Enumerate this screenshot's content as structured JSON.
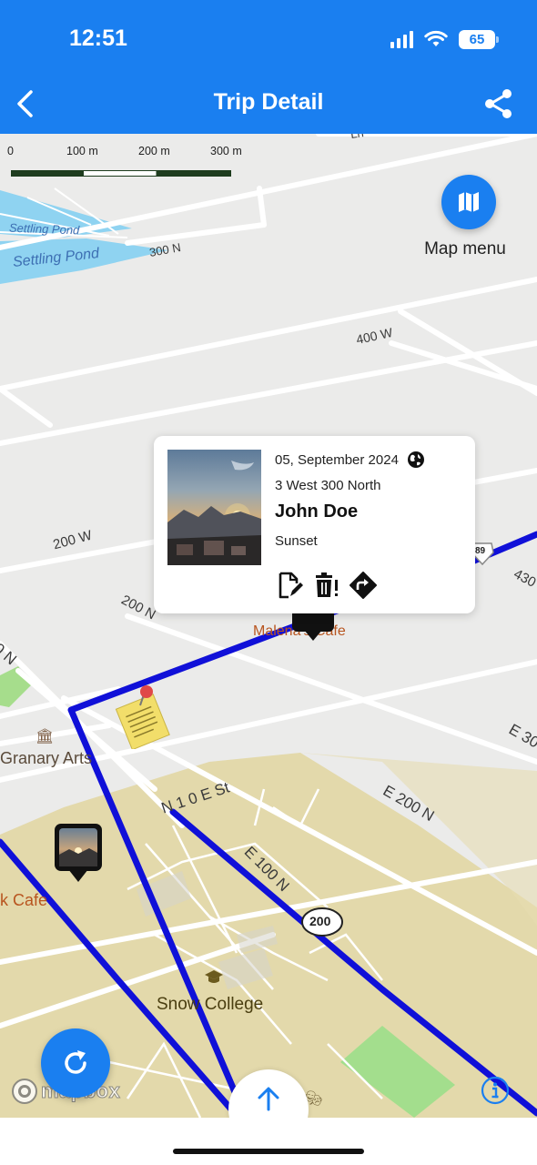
{
  "status_bar": {
    "time": "12:51",
    "battery": "65"
  },
  "header": {
    "title": "Trip Detail",
    "back_icon": "chevron-left-icon",
    "share_icon": "share-icon",
    "background": "#1a7ff0"
  },
  "map": {
    "scale": {
      "labels": [
        "0",
        "100 m",
        "200 m",
        "300 m"
      ]
    },
    "labels": {
      "pond_1": "Settling Pond",
      "pond_2": "Settling Pond",
      "street_300n": "300 N",
      "street_400w": "400 W",
      "street_200w": "200 W",
      "street_200n": "200 N",
      "street_n_left": "0 N",
      "street_430": "430",
      "street_e30": "E 30",
      "street_n1e": "N 1 0 E St",
      "street_e200n": "E 200 N",
      "street_e100n": "E 100 N",
      "route_shield": "200",
      "route_shield_2": "89",
      "poi_malena": "Malena's Cafe",
      "poi_granary": "Granary Arts",
      "poi_kcafe": "k Cafe",
      "poi_snow": "Snow College",
      "street_top": "Ln"
    },
    "route_color": "#1010d8"
  },
  "map_menu": {
    "label": "Map menu",
    "icon": "map-icon"
  },
  "popup": {
    "date": "05, September 2024",
    "address": "3 West 300 North",
    "name": "John Doe",
    "caption": "Sunset",
    "globe_icon": "globe-icon",
    "actions": {
      "edit_icon": "edit-note-icon",
      "delete_icon": "delete-icon",
      "directions_icon": "directions-icon"
    }
  },
  "controls": {
    "refresh_icon": "refresh-icon",
    "up_icon": "arrow-up-icon",
    "info_icon": "info-icon",
    "attribution": "mapbox"
  }
}
